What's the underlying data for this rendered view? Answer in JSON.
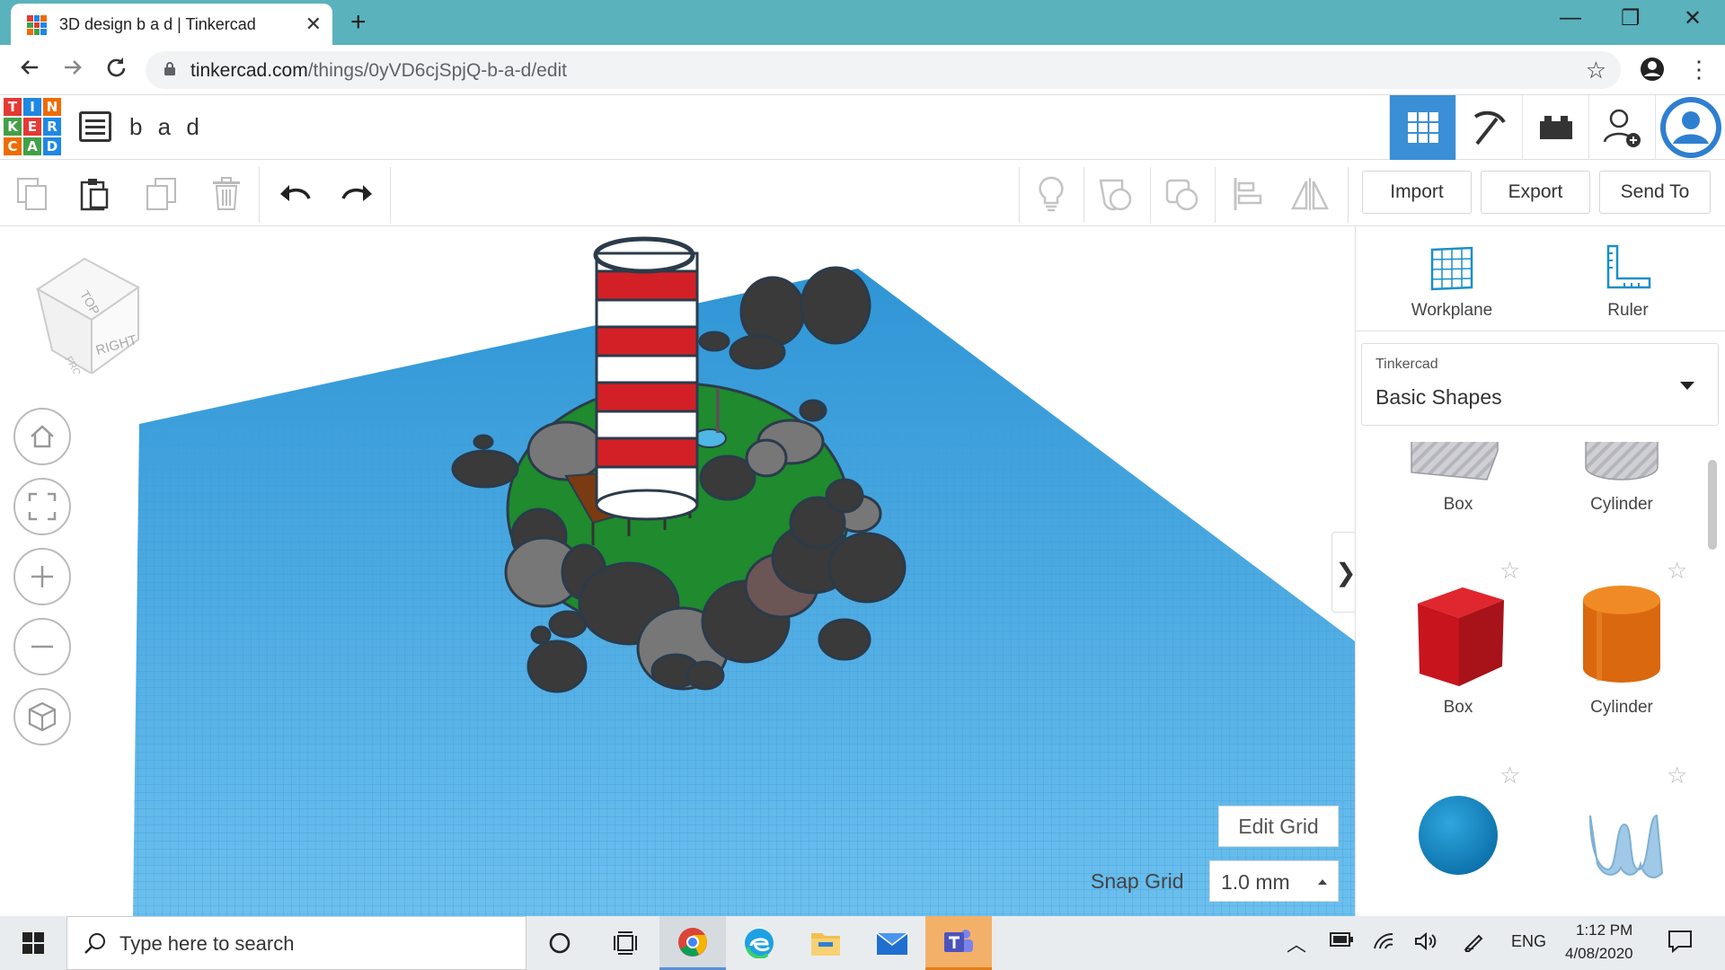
{
  "browser": {
    "tab_title": "3D design b a d | Tinkercad",
    "tab_close": "✕",
    "new_tab": "+",
    "url_host": "tinkercad.com",
    "url_path": "/things/0yVD6cjSpjQ-b-a-d/edit",
    "window_minimize": "—",
    "window_restore": "❐",
    "window_close": "✕"
  },
  "app": {
    "logo_letters": [
      "T",
      "I",
      "N",
      "K",
      "E",
      "R",
      "C",
      "A",
      "D"
    ],
    "logo_colors": [
      "#e53935",
      "#1e88e5",
      "#ef6c00",
      "#43a047",
      "#e53935",
      "#1e88e5",
      "#ef6c00",
      "#43a047",
      "#1e88e5"
    ],
    "design_name": "b a d",
    "header_buttons": [
      "grid-view-icon",
      "pickaxe-icon",
      "bricks-icon",
      "add-user-icon",
      "user-avatar"
    ]
  },
  "toolbar": {
    "import_label": "Import",
    "export_label": "Export",
    "sendto_label": "Send To"
  },
  "viewport": {
    "viewcube_top": "TOP",
    "viewcube_right": "RIGHT",
    "viewcube_front": "FRONT",
    "edit_grid_label": "Edit Grid",
    "snap_grid_label": "Snap Grid",
    "snap_grid_value": "1.0 mm",
    "collapse_label": "❯"
  },
  "panel": {
    "workplane_label": "Workplane",
    "ruler_label": "Ruler",
    "library_source": "Tinkercad",
    "library_name": "Basic Shapes",
    "shapes": [
      {
        "label": "Box"
      },
      {
        "label": "Cylinder"
      },
      {
        "label": "Box"
      },
      {
        "label": "Cylinder"
      }
    ]
  },
  "taskbar": {
    "search_placeholder": "Type here to search",
    "language": "ENG",
    "time": "1:12 PM",
    "date": "4/08/2020"
  },
  "colors": {
    "browser_chrome": "#5ab2bd",
    "workplane_blue": "#5fb6e8",
    "header_active": "#3a8fd6"
  }
}
